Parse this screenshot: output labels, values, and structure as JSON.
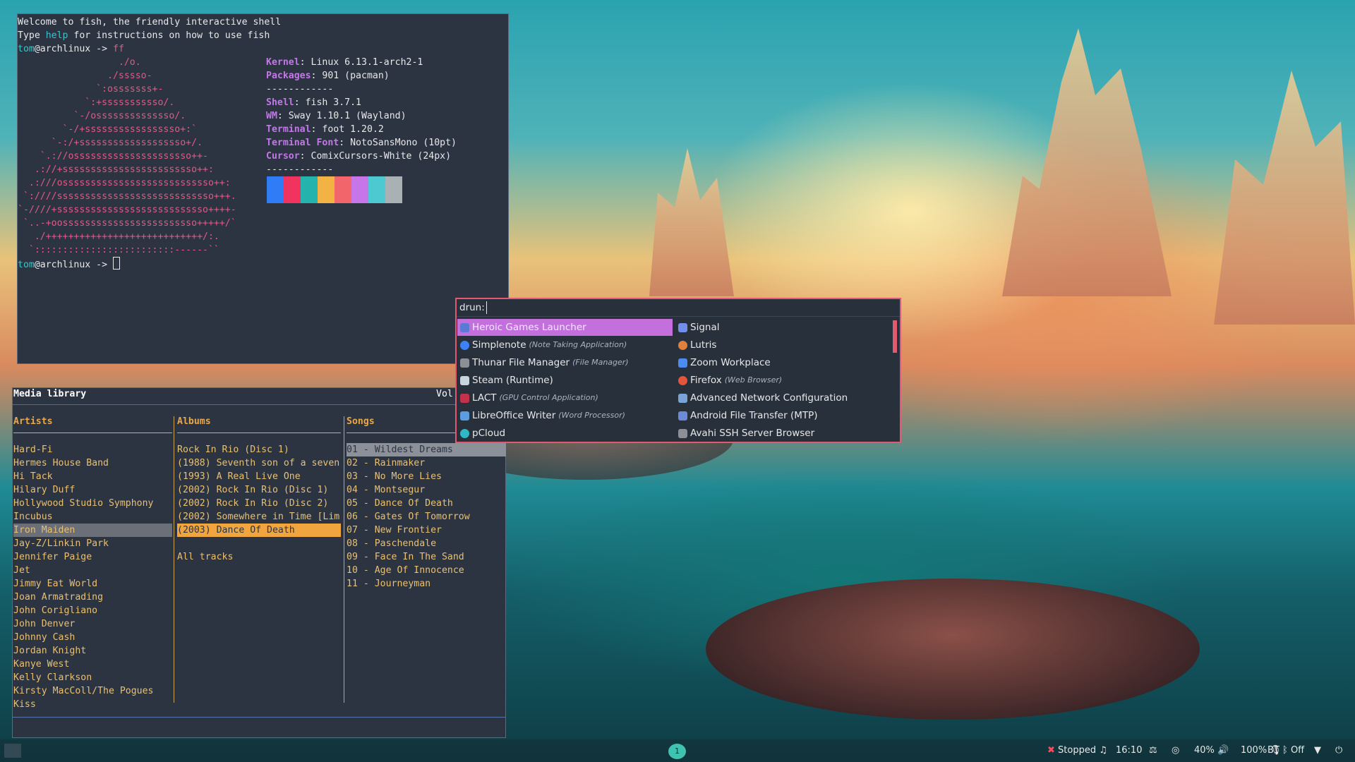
{
  "terminal": {
    "line1": "Welcome to fish, the friendly interactive shell",
    "line2_pre": "Type ",
    "line2_help": "help",
    "line2_post": " for instructions on how to use fish",
    "user": "tom",
    "host": "@archlinux",
    "arrow": " -> ",
    "command": "ff",
    "logo": [
      "                  ./o.",
      "                ./sssso-",
      "              `:osssssss+-",
      "            `:+sssssssssso/.",
      "          `-/ossssssssssssso/.",
      "        `-/+sssssssssssssssso+:`",
      "      `-:/+sssssssssssssssssso+/.",
      "    `.://osssssssssssssssssssso++-",
      "   .://+ssssssssssssssssssssssso++:",
      "  .:///osssssssssssssssssssssssssso++:",
      " `:////ssssssssssssssssssssssssssso+++.",
      "`-////+sssssssssssssssssssssssssso++++-",
      " `..-+oossssssssssssssssssssssso+++++/`",
      "   ./++++++++++++++++++++++++++++/:.",
      "  `:::::::::::::::::::::::::------``"
    ],
    "info": [
      {
        "key": "Kernel",
        "value": "Linux 6.13.1-arch2-1"
      },
      {
        "key": "Packages",
        "value": "901 (pacman)"
      },
      {
        "key": "",
        "value": "------------"
      },
      {
        "key": "Shell",
        "value": "fish 3.7.1"
      },
      {
        "key": "WM",
        "value": "Sway 1.10.1 (Wayland)"
      },
      {
        "key": "Terminal",
        "value": "foot 1.20.2"
      },
      {
        "key": "Terminal Font",
        "value": "NotoSansMono (10pt)"
      },
      {
        "key": "Cursor",
        "value": "ComixCursors-White (24px)"
      },
      {
        "key": "",
        "value": "------------"
      }
    ],
    "palette": [
      "#2f7cf6",
      "#f0345f",
      "#24b3ad",
      "#f2b344",
      "#f2656a",
      "#c676e8",
      "#4dc9d1",
      "#a9b1b5"
    ]
  },
  "media": {
    "title": "Media library",
    "vol_label": "Vol",
    "artists_header": "Artists",
    "albums_header": "Albums",
    "songs_header": "Songs",
    "artists": [
      "Hard-Fi",
      "Hermes House Band",
      "Hi Tack",
      "Hilary Duff",
      "Hollywood Studio Symphony",
      "Incubus",
      "Iron Maiden",
      "Jay-Z/Linkin Park",
      "Jennifer Paige",
      "Jet",
      "Jimmy Eat World",
      "Joan Armatrading",
      "John Corigliano",
      "John Denver",
      "Johnny Cash",
      "Jordan Knight",
      "Kanye West",
      "Kelly Clarkson",
      "Kirsty MacColl/The Pogues",
      "Kiss"
    ],
    "albums": [
      "Rock In Rio (Disc 1)",
      "(1988) Seventh son of a seven",
      "(1993) A Real Live One",
      "(2002) Rock In Rio (Disc 1)",
      "(2002) Rock In Rio (Disc 2)",
      "(2002) Somewhere in Time [Lim",
      "(2003) Dance Of Death",
      "",
      "All tracks"
    ],
    "songs": [
      "01 - Wildest Dreams",
      "02 - Rainmaker",
      "03 - No More Lies",
      "04 - Montsegur",
      "05 - Dance Of Death",
      "06 - Gates Of Tomorrow",
      "07 - New Frontier",
      "08 - Paschendale",
      "09 - Face In The Sand",
      "10 - Age Of Innocence",
      "11 - Journeyman"
    ]
  },
  "launcher": {
    "prompt": "drun:",
    "left": [
      {
        "name": "Heroic Games Launcher",
        "sub": "",
        "color": "#5a7ad6"
      },
      {
        "name": "Simplenote",
        "sub": "(Note Taking Application)",
        "color": "#3b82f6"
      },
      {
        "name": "Thunar File Manager",
        "sub": "(File Manager)",
        "color": "#8c8f96"
      },
      {
        "name": "Steam (Runtime)",
        "sub": "",
        "color": "#c7d5e0"
      },
      {
        "name": "LACT",
        "sub": "(GPU Control Application)",
        "color": "#c2334b"
      },
      {
        "name": "LibreOffice Writer",
        "sub": "(Word Processor)",
        "color": "#5a9ee0"
      },
      {
        "name": "pCloud",
        "sub": "",
        "color": "#2fb8c5"
      }
    ],
    "right": [
      {
        "name": "Signal",
        "sub": "",
        "color": "#6f8fe8"
      },
      {
        "name": "Lutris",
        "sub": "",
        "color": "#e0803a"
      },
      {
        "name": "Zoom Workplace",
        "sub": "",
        "color": "#4a8cf0"
      },
      {
        "name": "Firefox",
        "sub": "(Web Browser)",
        "color": "#e4563c"
      },
      {
        "name": "Advanced Network Configuration",
        "sub": "",
        "color": "#7aa3d8"
      },
      {
        "name": "Android File Transfer (MTP)",
        "sub": "",
        "color": "#6b8bd6"
      },
      {
        "name": "Avahi SSH Server Browser",
        "sub": "",
        "color": "#8c8f96"
      }
    ]
  },
  "statusbar": {
    "workspace": "1",
    "player_status": "Stopped",
    "time": "16:10",
    "brightness": "40%",
    "volume": "100%",
    "bluetooth": "BT",
    "bluetooth_state": "Off"
  }
}
